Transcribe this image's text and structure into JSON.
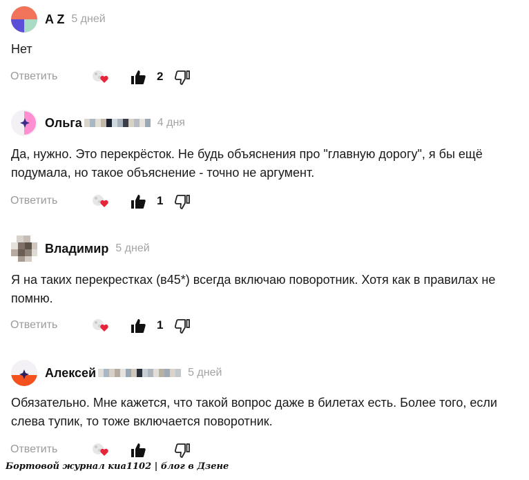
{
  "comments": [
    {
      "author": "A Z",
      "time": "5 дней",
      "text": "Нет",
      "reply_label": "Ответить",
      "likes": "2",
      "avatar_colors": [
        "#f0735a",
        "#5b4fd8",
        "#a8dcc4"
      ]
    },
    {
      "author": "Ольга",
      "time": "4 дня",
      "text": "Да, нужно. Это перекрёсток. Не будь объяснения про \"главную дорогу\", я бы ещё подумала, но такое объяснение - точно не аргумент.",
      "reply_label": "Ответить",
      "likes": "1",
      "avatar_colors": [
        "#f3f1f5",
        "#ff8fd1",
        "#3a2d8a"
      ]
    },
    {
      "author": "Владимир",
      "time": "5 дней",
      "text": "Я на таких перекрестках (в45*) всегда включаю поворотник. Хотя как в правилах не помню.",
      "reply_label": "Ответить",
      "likes": "1",
      "avatar_colors": [
        "#7e7066",
        "#b7aba1",
        "#5e5148"
      ]
    },
    {
      "author": "Алексей",
      "time": "5 дней",
      "text": "Обязательно. Мне кажется, что такой вопрос даже в билетах есть. Более того, если слева тупик, то тоже включается поворотник.",
      "reply_label": "Ответить",
      "likes": "",
      "avatar_colors": [
        "#f3f1f5",
        "#f4511e",
        "#2a2060"
      ]
    }
  ],
  "watermark": "Бортовой журнал киа1102 | блог в Дзене"
}
